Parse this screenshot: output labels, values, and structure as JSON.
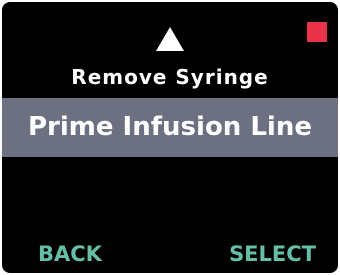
{
  "indicator": {
    "color": "#e8334a"
  },
  "scroll": {
    "up_icon": "triangle-up"
  },
  "menu": {
    "items": [
      {
        "label": "Remove Syringe"
      },
      {
        "label": "Prime Infusion Line"
      }
    ],
    "selected_label": "Prime Infusion Line"
  },
  "softkeys": {
    "left_label": "BACK",
    "right_label": "SELECT",
    "color": "#64bfa6"
  }
}
